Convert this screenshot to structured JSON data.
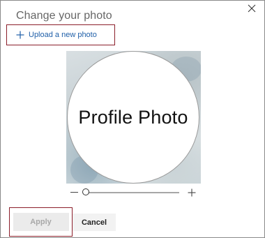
{
  "dialog": {
    "title": "Change your photo",
    "close_icon": "close-icon"
  },
  "upload": {
    "icon": "plus-icon",
    "label": "Upload a new photo"
  },
  "photo": {
    "placeholder_text": "Profile Photo"
  },
  "zoom": {
    "minus_icon": "minus-icon",
    "plus_icon": "plus-icon",
    "level_fraction": 0.0
  },
  "actions": {
    "apply_label": "Apply",
    "apply_disabled": true,
    "cancel_label": "Cancel"
  },
  "colors": {
    "link": "#1f5fa8",
    "highlight_border": "#8b1e2a",
    "disabled_text": "#a8a8a8"
  }
}
